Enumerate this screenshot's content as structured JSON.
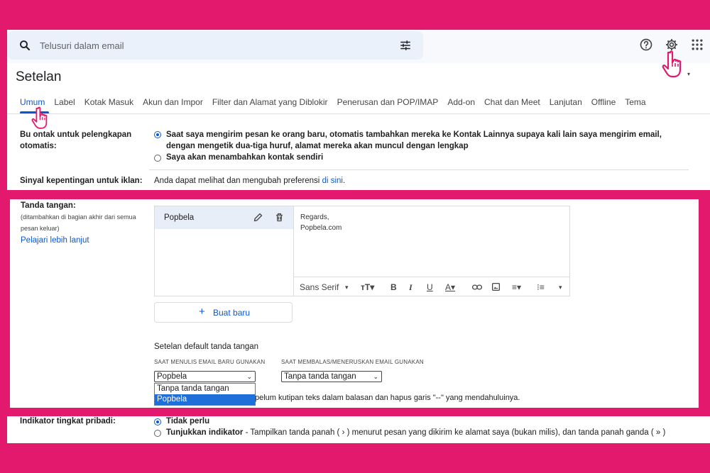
{
  "search": {
    "placeholder": "Telusuri dalam email"
  },
  "page_title": "Setelan",
  "tabs": [
    {
      "label": "Umum",
      "active": true
    },
    {
      "label": "Label"
    },
    {
      "label": "Kotak Masuk"
    },
    {
      "label": "Akun dan Impor"
    },
    {
      "label": "Filter dan Alamat yang Diblokir"
    },
    {
      "label": "Penerusan dan POP/IMAP"
    },
    {
      "label": "Add-on"
    },
    {
      "label": "Chat dan Meet"
    },
    {
      "label": "Lanjutan"
    },
    {
      "label": "Offline"
    },
    {
      "label": "Tema"
    }
  ],
  "contacts": {
    "label": "Buat kontak untuk pelengkapan otomatis:",
    "label_line1": "Bu    ontak untuk pelengkapan",
    "label_line2": "otomatis:",
    "option1_line1": "Saat saya mengirim pesan ke orang baru, otomatis tambahkan mereka ke Kontak Lainnya supaya kali lain saya mengirim email,",
    "option1_line2": "dengan mengetik dua-tiga huruf, alamat mereka akan muncul dengan lengkap",
    "option2": "Saya akan menambahkan kontak sendiri"
  },
  "ads": {
    "label": "Sinyal kepentingan untuk iklan:",
    "text": "Anda dapat melihat dan mengubah preferensi",
    "link": "di sini",
    "suffix": "."
  },
  "signature": {
    "label": "Tanda tangan:",
    "sub_line1": "(ditambahkan di bagian akhir dari semua",
    "sub_line2": "pesan keluar)",
    "learn_more": "Pelajari lebih lanjut",
    "item_name": "Popbela",
    "body_line1": "Regards,",
    "body_line2": "Popbela.com",
    "font": "Sans Serif",
    "new_button": "Buat baru",
    "defaults_title": "Setelan default tanda tangan",
    "new_email_caption": "SAAT MENULIS EMAIL BARU GUNAKAN",
    "reply_caption": "SAAT MEMBALAS/MENERUSKAN EMAIL GUNAKAN",
    "new_email_value": "Popbela",
    "reply_value": "Tanpa tanda tangan",
    "dropdown_options": [
      "Tanpa tanda tangan",
      "Popbela"
    ],
    "dropdown_selected": "Popbela",
    "insert_text": "pelum kutipan teks dalam balasan dan hapus garis \"--\" yang mendahuluinya."
  },
  "indicator": {
    "label": "Indikator tingkat pribadi:",
    "option1": "Tidak perlu",
    "option2_bold": "Tunjukkan indikator",
    "option2_rest": " - Tampilkan tanda panah ( › ) menurut pesan yang dikirim ke alamat saya (bukan milis), dan tanda panah ganda ( » )"
  },
  "colors": {
    "accent": "#0b57d0",
    "frame": "#e2196d",
    "cursor": "#e2196d"
  },
  "icons": [
    "search-icon",
    "tune-icon",
    "help-icon",
    "gear-icon",
    "apps-icon",
    "hand-cursor-icon",
    "pencil-icon",
    "trash-icon",
    "plus-icon"
  ]
}
